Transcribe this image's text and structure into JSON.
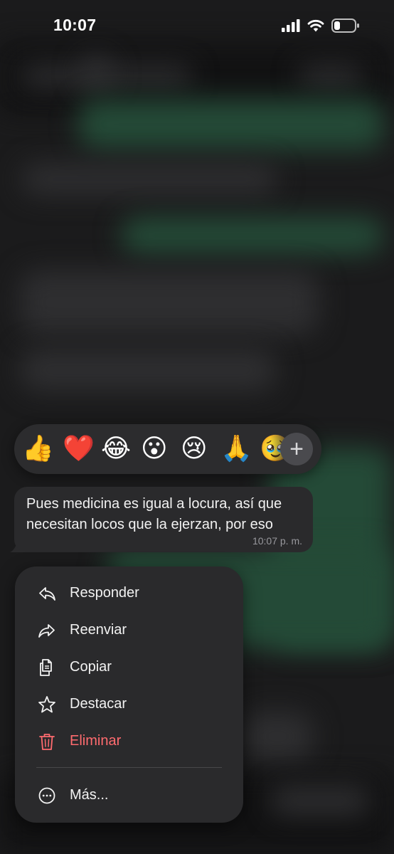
{
  "status_bar": {
    "time": "10:07"
  },
  "reactions": {
    "emojis": [
      "👍",
      "❤️",
      "😂",
      "😮",
      "😢",
      "🙏",
      "🥹"
    ],
    "more_label": "+"
  },
  "message": {
    "lines": [
      "Pues medicina es igual a locura, así que",
      "necesitan locos que la ejerzan, por eso"
    ],
    "time": "10:07 p. m."
  },
  "menu": {
    "items": [
      {
        "label": "Responder",
        "icon": "reply-icon"
      },
      {
        "label": "Reenviar",
        "icon": "forward-icon"
      },
      {
        "label": "Copiar",
        "icon": "copy-icon"
      },
      {
        "label": "Destacar",
        "icon": "star-icon"
      },
      {
        "label": "Eliminar",
        "icon": "trash-icon"
      },
      {
        "label": "Más...",
        "icon": "more-icon"
      }
    ]
  },
  "colors": {
    "danger": "#ff6b6f",
    "menu_bg": "#2a2a2c",
    "chat_green": "#244a37"
  }
}
